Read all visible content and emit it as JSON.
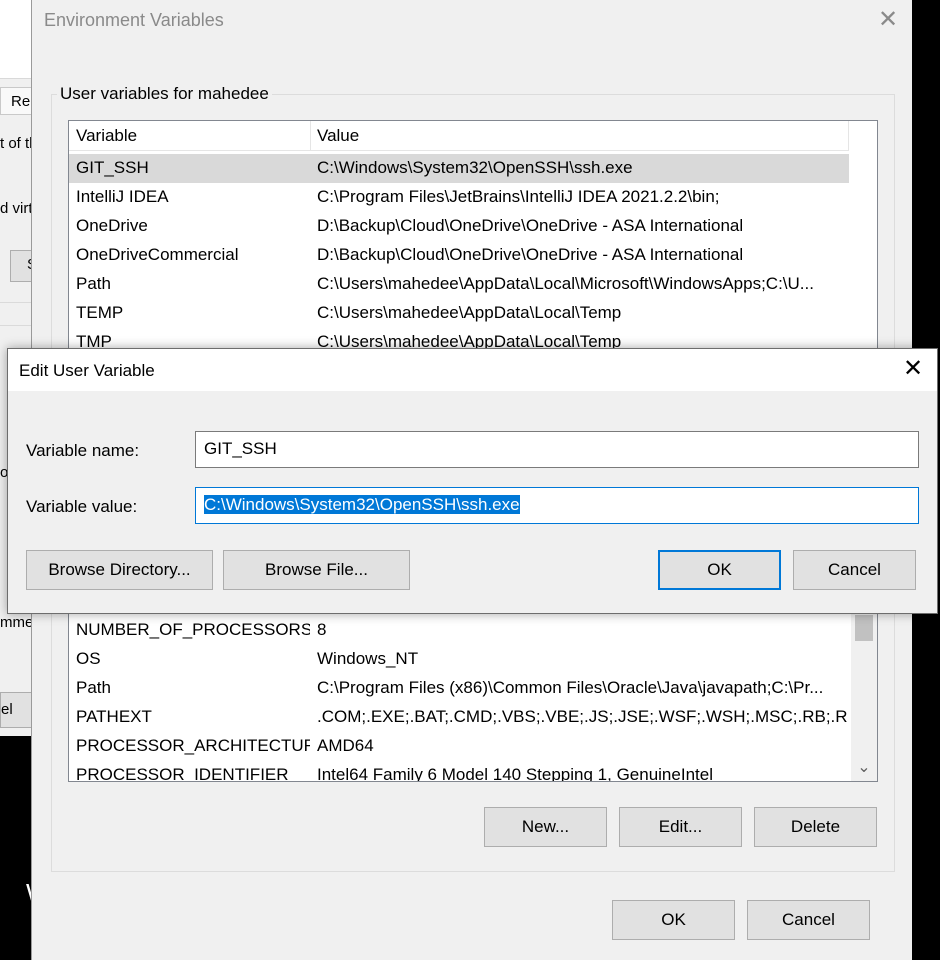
{
  "background_window": {
    "tab_label": "Re",
    "fragment_1": "t of th",
    "fragment_2": "d virt",
    "button_1": "S",
    "fragment_3": "o",
    "fragment_4": "mmen",
    "button_2": "el",
    "fragment_5": "W"
  },
  "env_dialog": {
    "title": "Environment Variables",
    "close_icon": "close-icon",
    "user_group_label": "User variables for mahedee",
    "columns": [
      "Variable",
      "Value"
    ],
    "user_vars": [
      {
        "name": "GIT_SSH",
        "value": "C:\\Windows\\System32\\OpenSSH\\ssh.exe"
      },
      {
        "name": "IntelliJ IDEA",
        "value": "C:\\Program Files\\JetBrains\\IntelliJ IDEA 2021.2.2\\bin;"
      },
      {
        "name": "OneDrive",
        "value": "D:\\Backup\\Cloud\\OneDrive\\OneDrive - ASA International"
      },
      {
        "name": "OneDriveCommercial",
        "value": "D:\\Backup\\Cloud\\OneDrive\\OneDrive - ASA International"
      },
      {
        "name": "Path",
        "value": "C:\\Users\\mahedee\\AppData\\Local\\Microsoft\\WindowsApps;C:\\U..."
      },
      {
        "name": "TEMP",
        "value": "C:\\Users\\mahedee\\AppData\\Local\\Temp"
      },
      {
        "name": "TMP",
        "value": "C:\\Users\\mahedee\\AppData\\Local\\Temp"
      }
    ],
    "system_vars": [
      {
        "name": "NUMBER_OF_PROCESSORS",
        "value": "8"
      },
      {
        "name": "OS",
        "value": "Windows_NT"
      },
      {
        "name": "Path",
        "value": "C:\\Program Files (x86)\\Common Files\\Oracle\\Java\\javapath;C:\\Pr..."
      },
      {
        "name": "PATHEXT",
        "value": ".COM;.EXE;.BAT;.CMD;.VBS;.VBE;.JS;.JSE;.WSF;.WSH;.MSC;.RB;.RBW"
      },
      {
        "name": "PROCESSOR_ARCHITECTURE",
        "value": "AMD64"
      },
      {
        "name": "PROCESSOR_IDENTIFIER",
        "value": "Intel64 Family 6 Model 140 Stepping 1, GenuineIntel"
      }
    ],
    "system_buttons": {
      "new": "New...",
      "edit": "Edit...",
      "delete": "Delete"
    },
    "footer_buttons": {
      "ok": "OK",
      "cancel": "Cancel"
    }
  },
  "edit_dialog": {
    "title": "Edit User Variable",
    "close_icon": "close-icon",
    "name_label": "Variable name:",
    "name_value": "GIT_SSH",
    "value_label": "Variable value:",
    "value_value": "C:\\Windows\\System32\\OpenSSH\\ssh.exe",
    "buttons": {
      "browse_directory": "Browse Directory...",
      "browse_file": "Browse File...",
      "ok": "OK",
      "cancel": "Cancel"
    },
    "accent_color": "#0078d7"
  }
}
